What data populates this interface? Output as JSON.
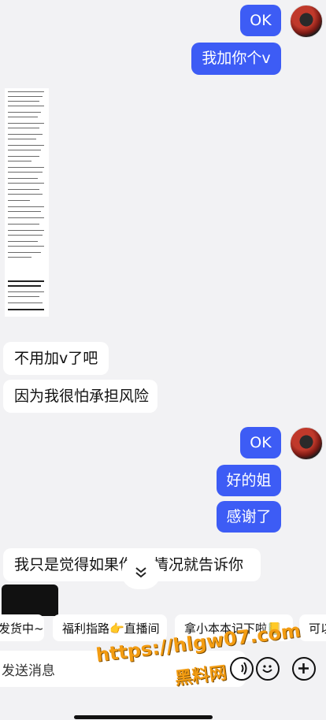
{
  "messages": {
    "m1": "OK",
    "m2": "我加你个v",
    "m3": "不用加v了吧",
    "m4": "因为我很怕承担风险",
    "m5": "OK",
    "m6": "好的姐",
    "m7": "感谢了",
    "m8": "我只是觉得如果你 的情况就告诉你"
  },
  "quick_chips": [
    "发货中~",
    "福利指路👉直播间",
    "拿小本本记下啦📒",
    "可以"
  ],
  "input": {
    "placeholder": "发送消息"
  },
  "watermark": {
    "url": "https://hlgw07.com",
    "name": "黑料网"
  },
  "colors": {
    "outgoing": "#3d5cf5",
    "incoming": "#ffffff",
    "background": "#f2f2f4"
  }
}
